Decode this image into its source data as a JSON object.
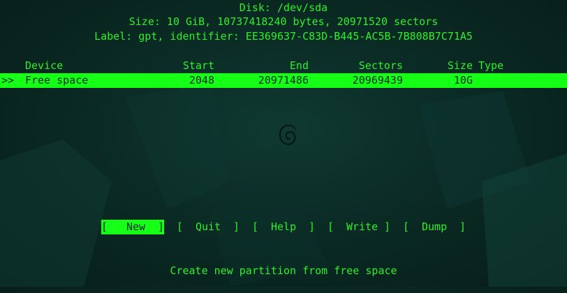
{
  "header": {
    "disk": "Disk: /dev/sda",
    "size": "Size: 10 GiB, 10737418240 bytes, 20971520 sectors",
    "label": "Label: gpt, identifier: EE369637-C83D-B445-AC5B-7B808B7C71A5"
  },
  "table": {
    "columns": {
      "device": "Device",
      "start": "Start",
      "end": "End",
      "sectors": "Sectors",
      "size": "Size",
      "type": "Type"
    },
    "rows": [
      {
        "marker": ">>",
        "device": "Free space",
        "start": "2048",
        "end": "20971486",
        "sectors": "20969439",
        "size": "10G",
        "type": ""
      }
    ]
  },
  "menu": [
    {
      "open": "[",
      "label": "New",
      "close": "]"
    },
    {
      "open": "[",
      "label": "Quit",
      "close": "]"
    },
    {
      "open": "[",
      "label": "Help",
      "close": "]"
    },
    {
      "open": "[",
      "label": "Write",
      "close": "]"
    },
    {
      "open": "[",
      "label": "Dump",
      "close": "]"
    }
  ],
  "status": "Create new partition from free space",
  "logo_icon": "debian-swirl-icon",
  "colors": {
    "text": "#2cf02c",
    "highlight": "#16ff16",
    "background": "#0b2b25"
  }
}
